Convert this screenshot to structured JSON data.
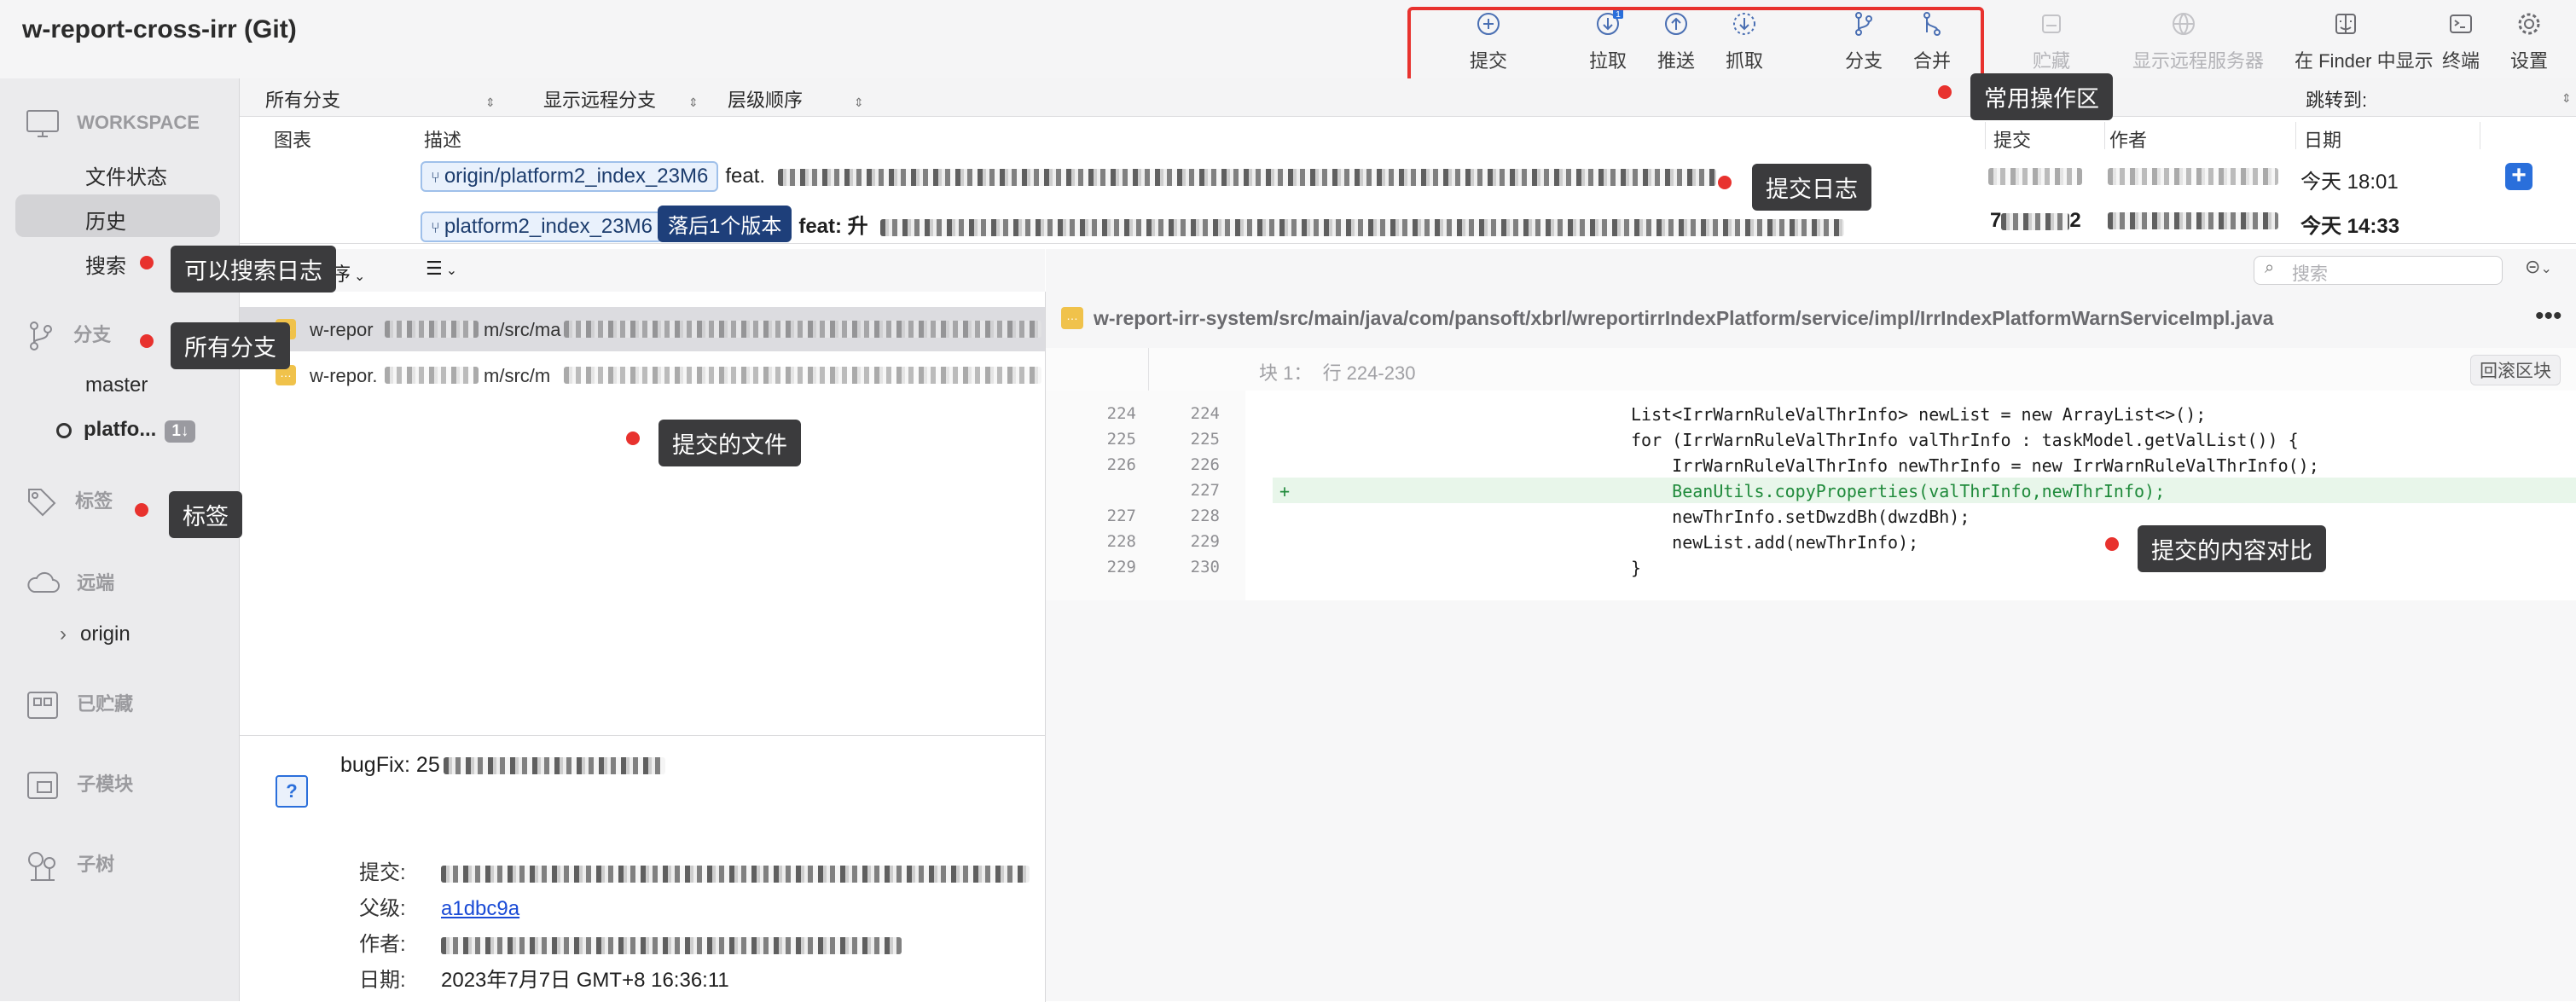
{
  "app": {
    "title": "w-report-cross-irr (Git)"
  },
  "toolbar": {
    "buttons": [
      {
        "label": "提交",
        "icon": "plus-circle-icon"
      },
      {
        "label": "拉取",
        "icon": "arrow-down-circle-icon",
        "badge": "1"
      },
      {
        "label": "推送",
        "icon": "arrow-up-circle-icon"
      },
      {
        "label": "抓取",
        "icon": "dashed-arrow-down-icon"
      },
      {
        "label": "分支",
        "icon": "branch-icon"
      },
      {
        "label": "合并",
        "icon": "merge-icon"
      },
      {
        "label": "贮藏",
        "icon": "stash-icon",
        "disabled": true
      },
      {
        "label": "显示远程服务器",
        "icon": "globe-icon",
        "disabled": true
      },
      {
        "label": "在 Finder 中显示",
        "icon": "finder-icon"
      },
      {
        "label": "终端",
        "icon": "terminal-icon"
      },
      {
        "label": "设置",
        "icon": "gear-icon"
      }
    ]
  },
  "sidebar": {
    "workspace_header": "WORKSPACE",
    "workspace_items": [
      "文件状态",
      "历史",
      "搜索"
    ],
    "branches_header": "分支",
    "branches": [
      "master",
      "platfo..."
    ],
    "branch_badge": "1↓",
    "tags_header": "标签",
    "remotes_header": "远端",
    "remotes": [
      "origin"
    ],
    "stashes_header": "已贮藏",
    "submodules_header": "子模块",
    "subtrees_header": "子树"
  },
  "filterbar": {
    "branch_filter": "所有分支",
    "remote_filter": "显示远程分支",
    "order_filter": "层级顺序",
    "jump_label": "跳转到:"
  },
  "commit_list": {
    "columns": [
      "图表",
      "描述",
      "提交",
      "作者",
      "日期"
    ],
    "rows": [
      {
        "ref": "origin/platform2_index_23M6",
        "message_prefix": "feat.",
        "date": "今天 18:01"
      },
      {
        "ref": "platform2_index_23M6",
        "ref_status": "落后1个版本",
        "message_prefix": "feat: 升",
        "commit_prefix": "7",
        "commit_suffix": "2",
        "date": "今天 14:33"
      }
    ]
  },
  "file_list": {
    "sort_label": "排序",
    "search_placeholder": "搜索",
    "files": [
      {
        "path_start": "w-repor",
        "path_mid": "m/src/ma"
      },
      {
        "path_start": "w-repor.",
        "path_mid": "m/src/m"
      }
    ]
  },
  "commit_detail": {
    "message": "bugFix: 25",
    "labels": {
      "commit": "提交:",
      "parent": "父级:",
      "author": "作者:",
      "date": "日期:"
    },
    "parent": "a1dbc9a",
    "date": "2023年7月7日 GMT+8 16:36:11"
  },
  "diff": {
    "file_path": "w-report-irr-system/src/main/java/com/pansoft/xbrl/wreportirrIndexPlatform/service/impl/IrrIndexPlatformWarnServiceImpl.java",
    "hunk_label": "块 1：  行 224-230",
    "revert_label": "回滚区块",
    "lines": [
      {
        "old": "224",
        "new": "224",
        "type": "context",
        "text": "List<IrrWarnRuleValThrInfo> newList = new ArrayList<>();"
      },
      {
        "old": "225",
        "new": "225",
        "type": "context",
        "text": "for (IrrWarnRuleValThrInfo valThrInfo : taskModel.getValList()) {"
      },
      {
        "old": "226",
        "new": "226",
        "type": "context",
        "text": "    IrrWarnRuleValThrInfo newThrInfo = new IrrWarnRuleValThrInfo();"
      },
      {
        "old": "",
        "new": "227",
        "type": "added",
        "text": "    BeanUtils.copyProperties(valThrInfo,newThrInfo);"
      },
      {
        "old": "227",
        "new": "228",
        "type": "context",
        "text": "    newThrInfo.setDwzdBh(dwzdBh);"
      },
      {
        "old": "228",
        "new": "229",
        "type": "context",
        "text": "    newList.add(newThrInfo);"
      },
      {
        "old": "229",
        "new": "230",
        "type": "context",
        "text": "}"
      }
    ]
  },
  "annotations": {
    "toolbar": "常用操作区",
    "commit_log": "提交日志",
    "search": "可以搜索日志",
    "branches": "所有分支",
    "files": "提交的文件",
    "tags": "标签",
    "diff": "提交的内容对比"
  },
  "colors": {
    "highlight_red": "#e8322e",
    "callout_bg": "#3b3b3d",
    "graph_blue": "#2a6fdb",
    "added_bg": "#e8f6ea",
    "added_text": "#1f8a3b"
  }
}
